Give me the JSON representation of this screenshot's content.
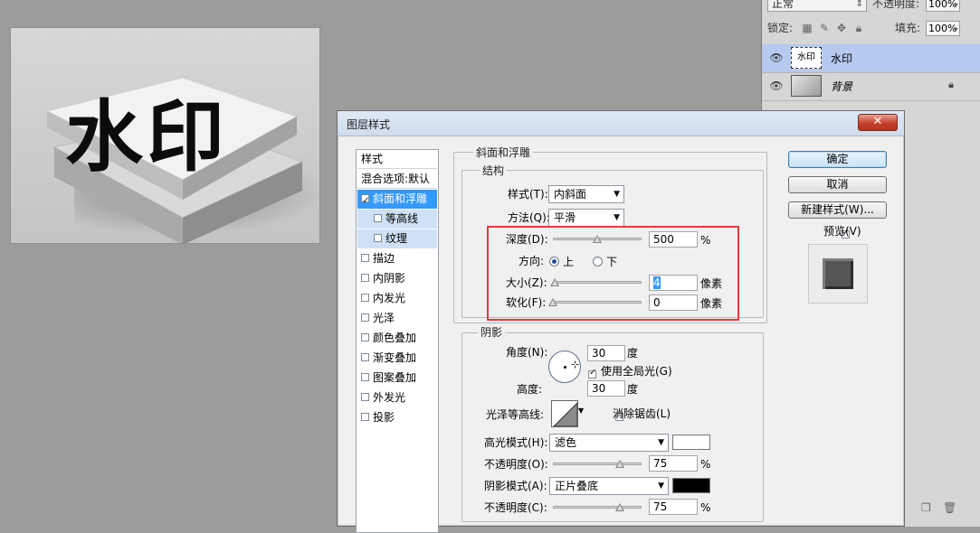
{
  "layers_panel": {
    "blend_mode": "正常",
    "opacity_label": "不透明度:",
    "opacity_value": "100%",
    "lock_label": "锁定:",
    "fill_label": "填充:",
    "fill_value": "100%",
    "layers": [
      {
        "name": "水印",
        "thumb_text": "水印",
        "selected": true,
        "locked": false
      },
      {
        "name": "背景",
        "thumb_text": "",
        "selected": false,
        "locked": true
      }
    ]
  },
  "canvas": {
    "watermark_text": "水印"
  },
  "dialog": {
    "title": "图层样式",
    "close_label": "✕",
    "style_list": {
      "header": "样式",
      "blend_options": "混合选项:默认",
      "items": [
        {
          "label": "斜面和浮雕",
          "checked": true,
          "selected": true,
          "sub": false
        },
        {
          "label": "等高线",
          "checked": false,
          "selected": false,
          "sub": true
        },
        {
          "label": "纹理",
          "checked": false,
          "selected": false,
          "sub": true
        },
        {
          "label": "描边",
          "checked": false,
          "selected": false,
          "sub": false
        },
        {
          "label": "内阴影",
          "checked": false,
          "selected": false,
          "sub": false
        },
        {
          "label": "内发光",
          "checked": false,
          "selected": false,
          "sub": false
        },
        {
          "label": "光泽",
          "checked": false,
          "selected": false,
          "sub": false
        },
        {
          "label": "颜色叠加",
          "checked": false,
          "selected": false,
          "sub": false
        },
        {
          "label": "渐变叠加",
          "checked": false,
          "selected": false,
          "sub": false
        },
        {
          "label": "图案叠加",
          "checked": false,
          "selected": false,
          "sub": false
        },
        {
          "label": "外发光",
          "checked": false,
          "selected": false,
          "sub": false
        },
        {
          "label": "投影",
          "checked": false,
          "selected": false,
          "sub": false
        }
      ]
    },
    "bevel": {
      "section_title": "斜面和浮雕",
      "structure_title": "结构",
      "style_label": "样式(T):",
      "style_value": "内斜面",
      "technique_label": "方法(Q):",
      "technique_value": "平滑",
      "depth_label": "深度(D):",
      "depth_value": "500",
      "depth_unit": "%",
      "depth_slider_fraction": 0.5,
      "direction_label": "方向:",
      "direction_up": "上",
      "direction_down": "下",
      "direction_selected": "上",
      "size_label": "大小(Z):",
      "size_value": "4",
      "size_unit": "像素",
      "size_slider_fraction": 0.02,
      "soften_label": "软化(F):",
      "soften_value": "0",
      "soften_unit": "像素",
      "soften_slider_fraction": 0.0
    },
    "shading": {
      "title": "阴影",
      "angle_label": "角度(N):",
      "angle_value": "30",
      "angle_unit": "度",
      "global_light_label": "使用全局光(G)",
      "global_light_checked": true,
      "altitude_label": "高度:",
      "altitude_value": "30",
      "altitude_unit": "度",
      "gloss_contour_label": "光泽等高线:",
      "anti_alias_label": "消除锯齿(L)",
      "anti_alias_checked": false,
      "highlight_mode_label": "高光模式(H):",
      "highlight_mode_value": "滤色",
      "highlight_color": "#ffffff",
      "highlight_opacity_label": "不透明度(O):",
      "highlight_opacity_value": "75",
      "highlight_opacity_unit": "%",
      "highlight_opacity_fraction": 0.75,
      "shadow_mode_label": "阴影模式(A):",
      "shadow_mode_value": "正片叠底",
      "shadow_color": "#000000",
      "shadow_opacity_label": "不透明度(C):",
      "shadow_opacity_value": "75",
      "shadow_opacity_unit": "%",
      "shadow_opacity_fraction": 0.75
    },
    "buttons": {
      "ok": "确定",
      "cancel": "取消",
      "new_style": "新建样式(W)...",
      "preview_label": "预览(V)",
      "preview_checked": true
    }
  },
  "colors": {
    "selection_blue": "#3399ff",
    "highlight_red": "#e53b3b"
  }
}
